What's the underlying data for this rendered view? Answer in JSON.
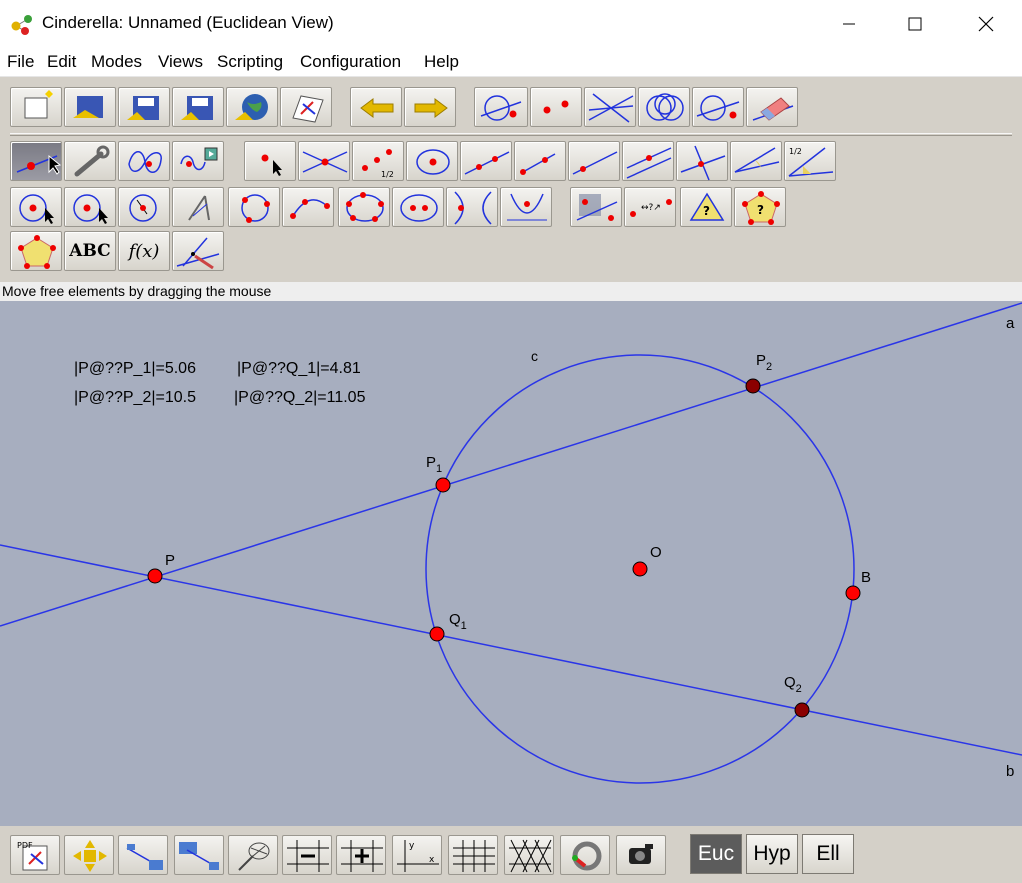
{
  "window": {
    "title": "Cinderella: Unnamed (Euclidean View)",
    "controls": [
      "minimize-icon",
      "maximize-icon",
      "close-icon"
    ]
  },
  "menu": [
    "File",
    "Edit",
    "Modes",
    "Views",
    "Scripting",
    "Configuration",
    "Help"
  ],
  "toolbar": {
    "file_tools": [
      "new-document-icon",
      "open-file-icon",
      "save-icon",
      "save-as-icon",
      "export-web-icon",
      "print-icon"
    ],
    "history_tools": [
      "undo-arrow-icon",
      "redo-arrow-icon"
    ],
    "selection_tools": [
      "select-all-icon",
      "select-points-icon",
      "select-lines-icon",
      "select-circles-icon",
      "deselect-icon",
      "eraser-icon"
    ],
    "mode_row1": [
      "move-mode-icon",
      "wrench-icon",
      "locus-icon",
      "animation-icon",
      "add-point-icon",
      "intersection-icon",
      "midpoint-icon",
      "circle-by-point-icon",
      "line-through-points-icon",
      "segment-icon",
      "line-through-point-icon",
      "parallel-icon",
      "perpendicular-icon",
      "angle-bisector-icon",
      "angle-icon",
      "half-angle-icon"
    ],
    "mode_row2": [
      "circle-by-radius-icon",
      "circle-by-center-icon",
      "compass-circle-icon",
      "compass-icon",
      "circle-by-three-points-icon",
      "arc-icon",
      "conic-five-points-icon",
      "ellipse-icon",
      "hyperbola-icon",
      "parabola-icon",
      "transform-icon",
      "distance-icon",
      "angle-measure-icon",
      "polygon-measure-icon"
    ],
    "mode_row3": [
      "polygon-icon",
      "text-icon",
      "function-icon",
      "segment-measure-icon"
    ],
    "text_tool_label": "ABC",
    "function_tool_label": "f(x)"
  },
  "status": {
    "message": "Move free elements by dragging the mouse"
  },
  "canvas": {
    "background": "#a7aebf",
    "line_color": "#2a35e8",
    "point_color": "#ff0000",
    "dark_point_color": "#8b0000",
    "measurements": [
      {
        "label": "|P@??P_1|=5.06"
      },
      {
        "label": "|P@??Q_1|=4.81"
      },
      {
        "label": "|P@??P_2|=10.5"
      },
      {
        "label": "|P@??Q_2|=11.05"
      }
    ],
    "labels": {
      "line_a": "a",
      "line_b": "b",
      "circle_c": "c",
      "point_P": "P",
      "point_P1": "P",
      "point_P1_sub": "1",
      "point_P2": "P",
      "point_P2_sub": "2",
      "point_Q1": "Q",
      "point_Q1_sub": "1",
      "point_Q2": "Q",
      "point_Q2_sub": "2",
      "point_O": "O",
      "point_B": "B"
    }
  },
  "bottom_toolbar": {
    "tools": [
      "pdf-export-icon",
      "move-view-icon",
      "zoom-in-icon",
      "zoom-out-icon",
      "net-icon",
      "grid-coarse-icon",
      "grid-fine-icon",
      "axes-icon",
      "square-grid-icon",
      "triangle-grid-icon",
      "snap-icon",
      "camera-icon"
    ],
    "geometry_modes": [
      "Euc",
      "Hyp",
      "Ell"
    ],
    "active_geometry": "Euc"
  }
}
